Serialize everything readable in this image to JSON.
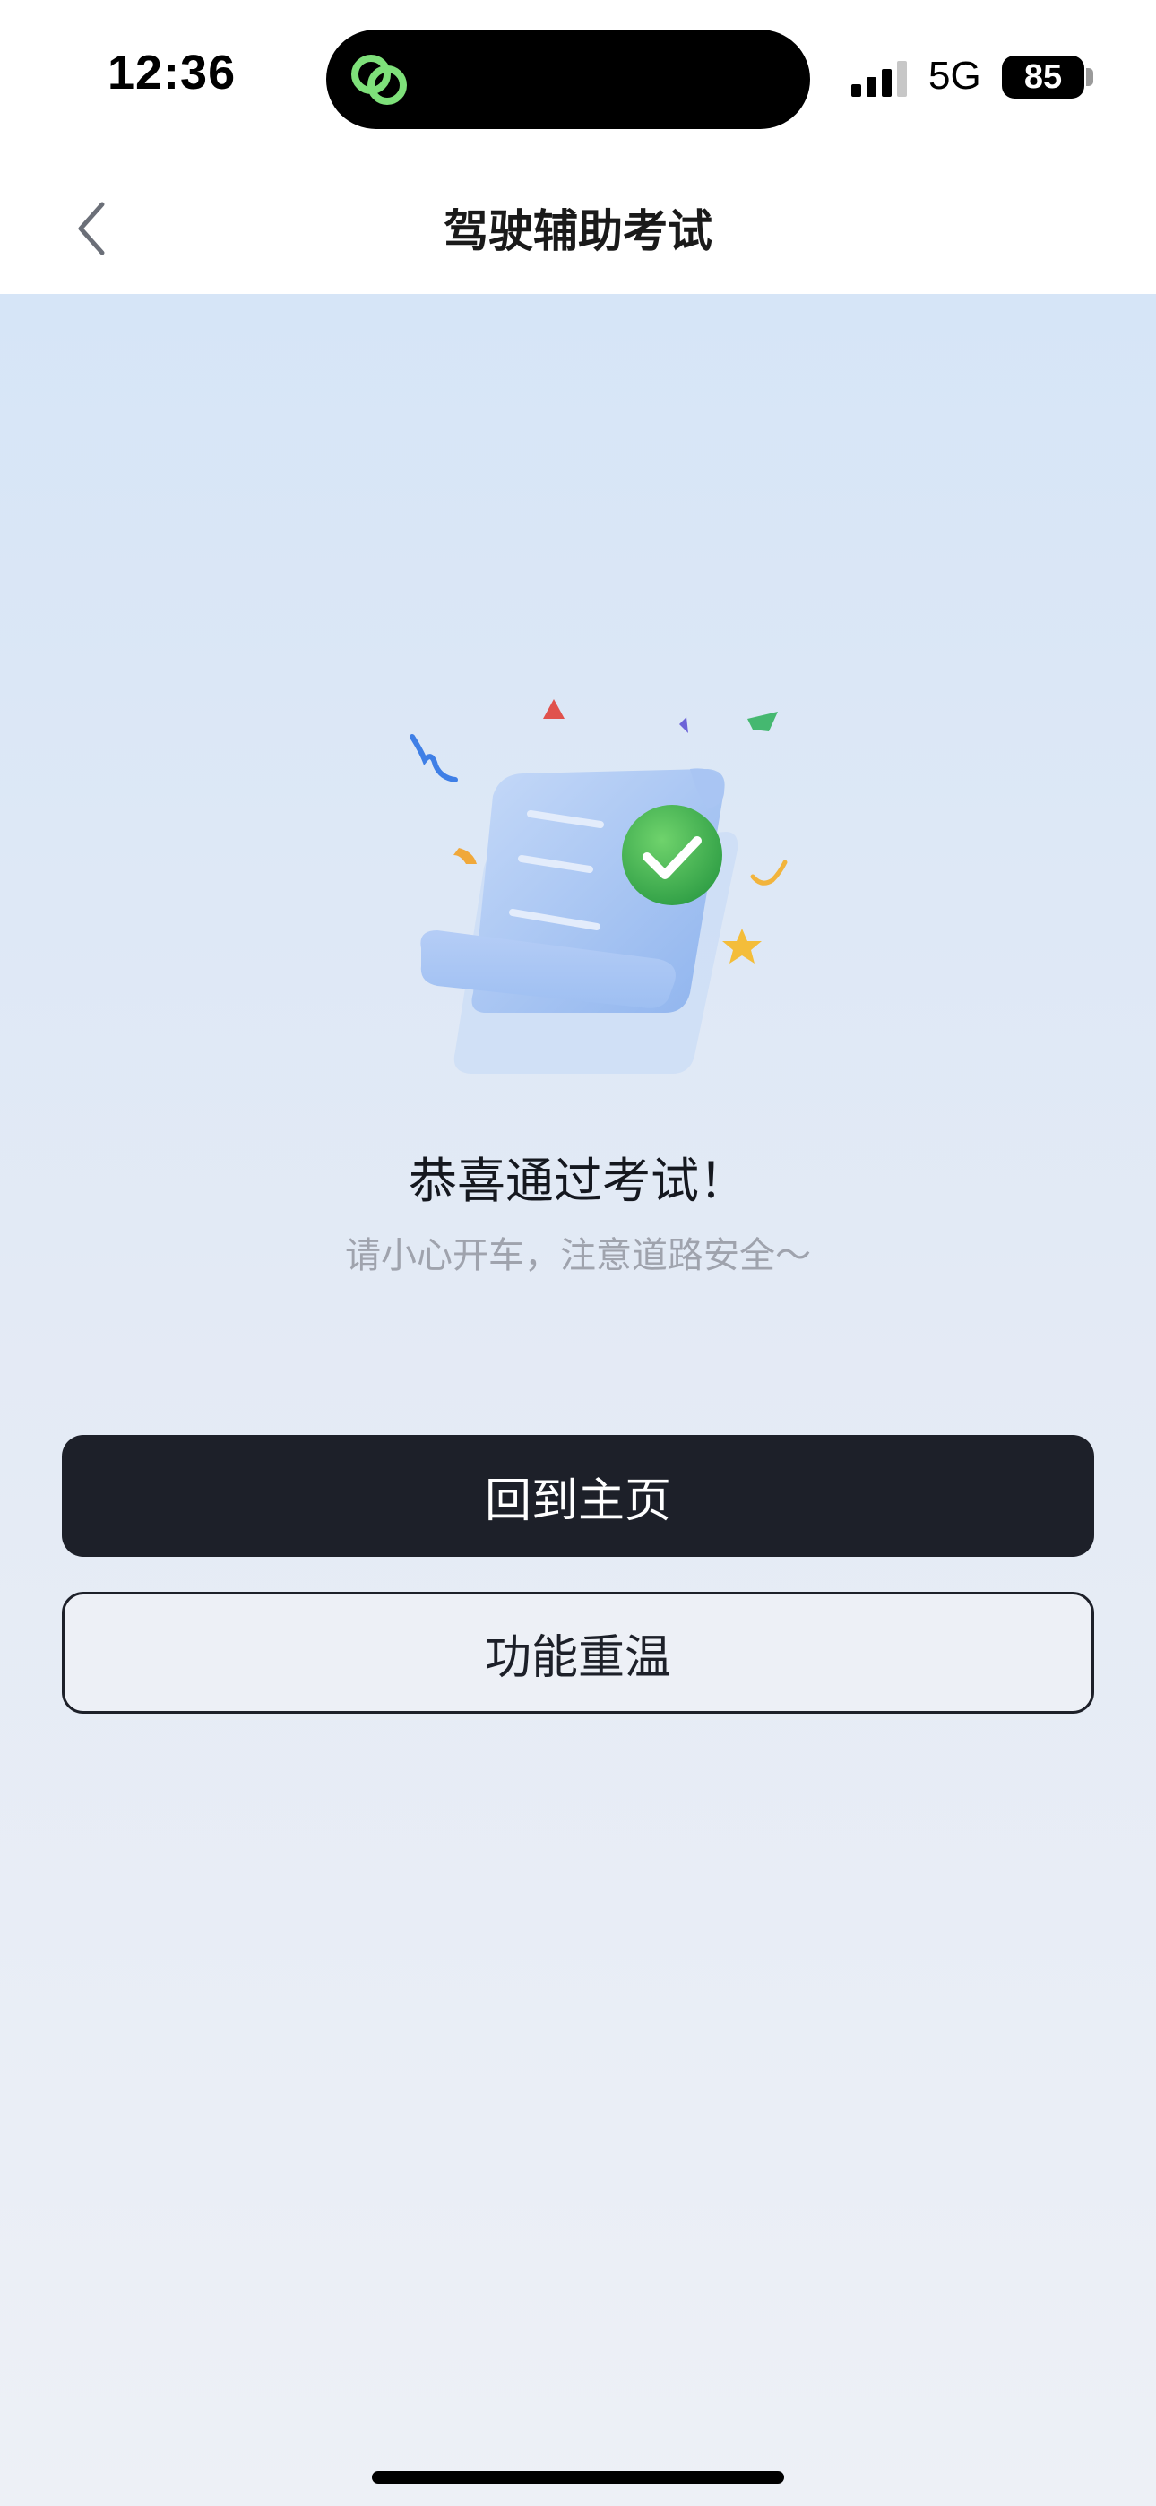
{
  "status_bar": {
    "time": "12:36",
    "network": "5G",
    "battery": "85"
  },
  "nav": {
    "title": "驾驶辅助考试"
  },
  "result": {
    "title": "恭喜通过考试！",
    "subtitle": "请小心开车，注意道路安全～"
  },
  "actions": {
    "home_label": "回到主页",
    "review_label": "功能重温"
  },
  "colors": {
    "primary_button": "#1d2029",
    "success_green": "#4cbf5a",
    "background_top": "#d6e5f7",
    "background_bottom": "#edf0f6"
  },
  "icons": {
    "back": "chevron-left-icon",
    "status_app": "app-link-icon",
    "signal": "signal-icon",
    "success": "check-circle-icon"
  }
}
